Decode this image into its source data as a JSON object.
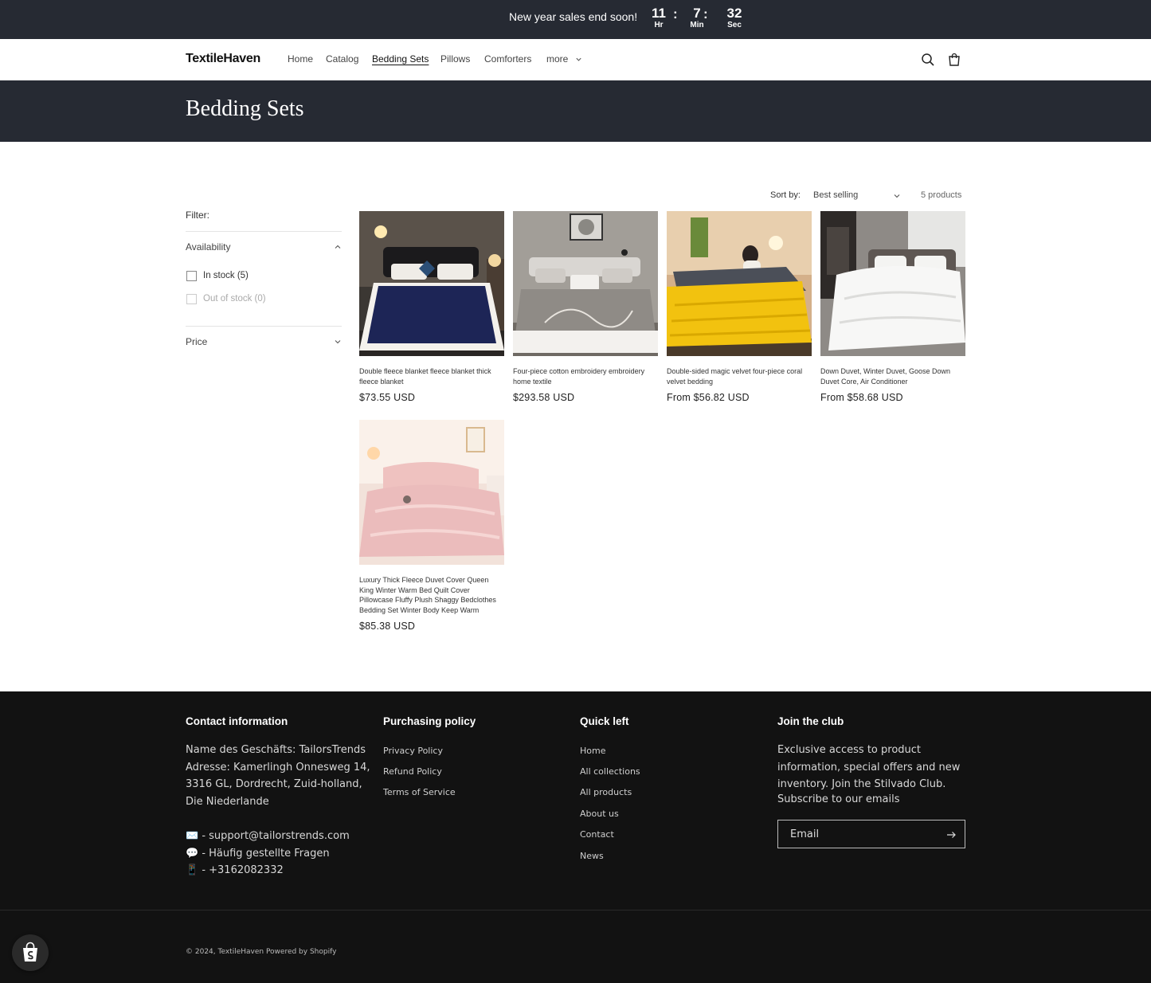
{
  "announcement": {
    "text": "New year sales end soon!",
    "countdown": [
      {
        "value": "11",
        "label": "Hr"
      },
      {
        "value": "7",
        "label": "Min"
      },
      {
        "value": "32",
        "label": "Sec"
      }
    ],
    "separator": ":"
  },
  "header": {
    "logo": "TextileHaven",
    "nav": [
      "Home",
      "Catalog",
      "Bedding Sets",
      "Pillows",
      "Comforters",
      "more"
    ],
    "active_nav": "Bedding Sets"
  },
  "collection": {
    "title": "Bedding Sets",
    "sort_label": "Sort by:",
    "sort_value": "Best selling",
    "product_count": "5 products"
  },
  "filter": {
    "label": "Filter:",
    "availability": {
      "title": "Availability",
      "options": [
        {
          "label": "In stock (5)",
          "checked": false,
          "disabled": false
        },
        {
          "label": "Out of stock (0)",
          "checked": false,
          "disabled": true
        }
      ]
    },
    "price": {
      "title": "Price"
    }
  },
  "products": [
    {
      "title": "Double fleece blanket fleece blanket thick fleece blanket",
      "price": "$73.55 USD"
    },
    {
      "title": "Four-piece cotton embroidery embroidery home textile",
      "price": "$293.58 USD"
    },
    {
      "title": "Double-sided magic velvet four-piece coral velvet bedding",
      "price": "From $56.82 USD"
    },
    {
      "title": "Down Duvet, Winter Duvet, Goose Down Duvet Core, Air Conditioner",
      "price": "From $58.68 USD"
    },
    {
      "title": "Luxury Thick Fleece Duvet Cover Queen King Winter Warm Bed Quilt Cover Pillowcase Fluffy Plush Shaggy Bedclothes Bedding Set Winter Body Keep Warm",
      "price": "$85.38 USD"
    }
  ],
  "footer": {
    "contact": {
      "title": "Contact information",
      "address": "Name des Geschäfts: TailorsTrends Adresse: Kamerlingh Onnesweg 14, 3316 GL, Dordrecht, Zuid-holland, Die Niederlande",
      "email_line": "✉️ - support@tailorstrends.com",
      "faq_line": "💬 - Häufig gestellte Fragen",
      "phone_line": "📱 - +3162082332"
    },
    "policy": {
      "title": "Purchasing policy",
      "links": [
        "Privacy Policy",
        "Refund Policy",
        "Terms of Service"
      ]
    },
    "quick": {
      "title": "Quick left",
      "links": [
        "Home",
        "All collections",
        "All products",
        "About us",
        "Contact",
        "News"
      ]
    },
    "club": {
      "title": "Join the club",
      "text": "Exclusive access to product information, special offers and new inventory. Join the Stilvado Club.",
      "subscribe": "Subscribe to our emails",
      "email_placeholder": "Email"
    },
    "copyright": "© 2024, TextileHaven Powered by Shopify"
  },
  "colors": {
    "dark_banner": "#262a33",
    "footer_bg": "#121212"
  }
}
